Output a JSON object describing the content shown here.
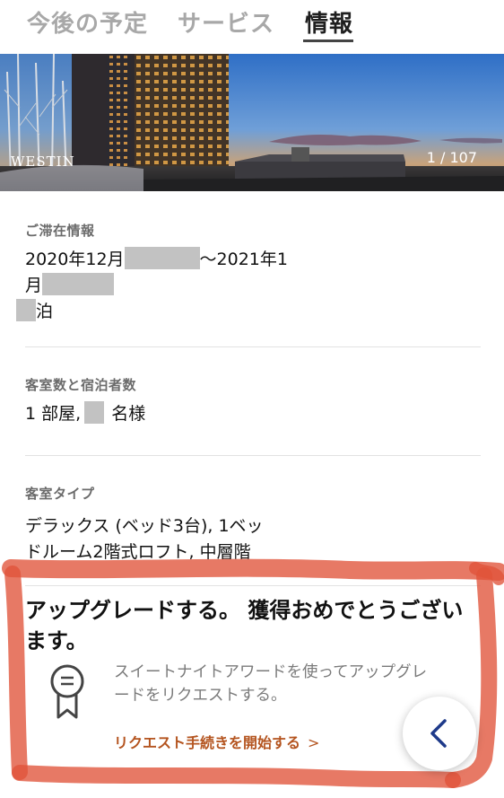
{
  "tabs": [
    {
      "label": "今後の予定",
      "active": false
    },
    {
      "label": "サービス",
      "active": false
    },
    {
      "label": "情報",
      "active": true
    }
  ],
  "banner": {
    "brand": "WESTIN",
    "photo_counter": "1 / 107"
  },
  "stay": {
    "label": "ご滞在情報",
    "date_prefix": "2020年12月",
    "date_mid": "～2021年1",
    "date_month_suffix": "月",
    "nights_suffix": "泊"
  },
  "rooms": {
    "label": "客室数と宿泊者数",
    "rooms_text": "1 部屋,",
    "guests_suffix": "名様"
  },
  "room_type": {
    "label": "客室タイプ",
    "line1": "デラックス (ベッド3台), 1ベッ",
    "line2": "ドルーム2階式ロフト, 中層階"
  },
  "upgrade": {
    "title": "アップグレードする。 獲得おめでとうございます。",
    "description": "スイートナイトアワードを使ってアップグレードをリクエストする。",
    "link_label": "リクエスト手続きを開始する",
    "link_chevron": "＞",
    "icon": "award-ribbon-icon"
  },
  "fab": {
    "icon": "chevron-left-icon"
  },
  "colors": {
    "accent": "#b4541f",
    "annotation": "#e0533a",
    "fab_chevron": "#1e3a8a"
  }
}
